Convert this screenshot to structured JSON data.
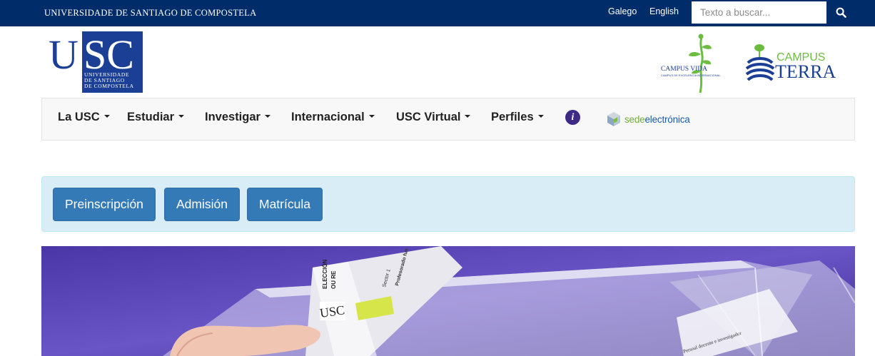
{
  "topbar": {
    "university_name": "UNIVERSIDADE DE SANTIAGO DE COMPOSTELA",
    "languages": [
      "Galego",
      "English"
    ],
    "search": {
      "placeholder": "Texto a buscar...",
      "icon": "search-icon"
    }
  },
  "header": {
    "logo": {
      "letters": "USC",
      "subtitle_lines": [
        "UNIVERSIDADE",
        "DE SANTIAGO",
        "DE COMPOSTELA"
      ]
    },
    "campus_vida": {
      "title": "CAMPUS VIDA",
      "caption": "CAMPUS DE EXCELENCIA INTERNACIONAL"
    },
    "campus_terra": {
      "line1": "CAMPUS",
      "line2": "TERRA"
    }
  },
  "nav": {
    "items": [
      "La USC",
      "Estudiar",
      "Investigar",
      "Internacional",
      "USC Virtual",
      "Perfiles"
    ],
    "info_icon": "info-icon",
    "sede": {
      "part1": "sede",
      "part2": "electrónica"
    }
  },
  "actions": {
    "buttons": [
      "Preinscripción",
      "Admisión",
      "Matrícula"
    ]
  },
  "hero": {
    "ballot_text": [
      "ELECCIÓN",
      "OU RE",
      "Sector 1",
      "Profesorado fun"
    ],
    "ballot_logo": "USC",
    "box_text": [
      "Persoal docente e investigador"
    ]
  },
  "colors": {
    "topbar": "#002d6a",
    "navbar_bg": "#f8f8f8",
    "alert_bg": "#d9edf7",
    "button_primary": "#337ab7",
    "hero_bg": "#5a43b8"
  }
}
